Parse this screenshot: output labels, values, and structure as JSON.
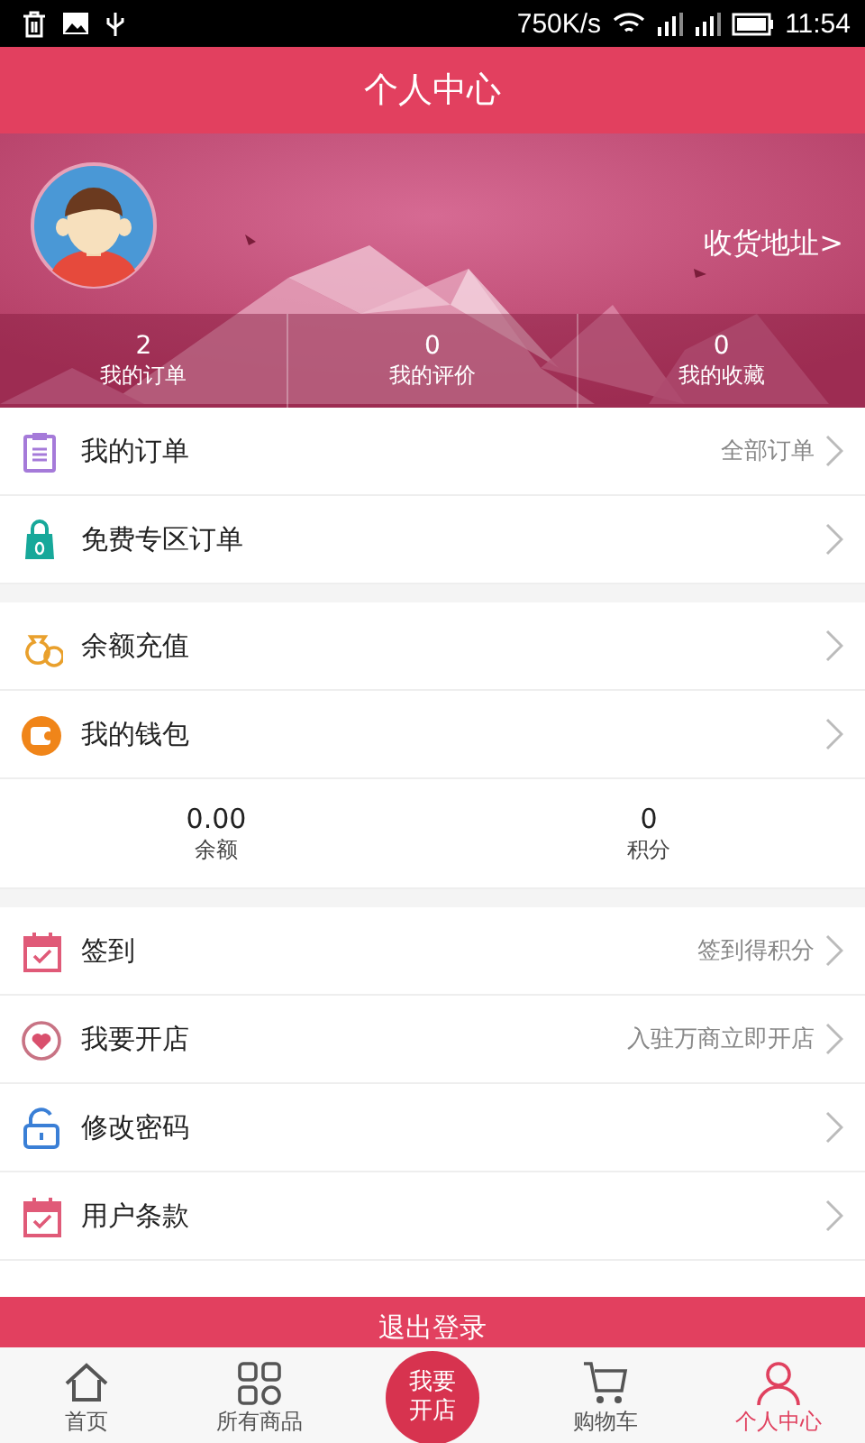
{
  "status_bar": {
    "speed": "750K/s",
    "time": "11:54"
  },
  "header": {
    "title": "个人中心"
  },
  "profile": {
    "address_link": "收货地址",
    "address_arrow": ">",
    "stats": [
      {
        "value": "2",
        "label": "我的订单"
      },
      {
        "value": "0",
        "label": "我的评价"
      },
      {
        "value": "0",
        "label": "我的收藏"
      }
    ]
  },
  "groups": [
    {
      "items": [
        {
          "kind": "clipboard",
          "label": "我的订单",
          "hint": "全部订单"
        },
        {
          "kind": "bag",
          "label": "免费专区订单"
        }
      ]
    },
    {
      "items": [
        {
          "kind": "moneybag",
          "label": "余额充值"
        },
        {
          "kind": "wallet",
          "label": "我的钱包"
        }
      ],
      "balances": [
        {
          "value": "0.00",
          "label": "余额"
        },
        {
          "value": "0",
          "label": "积分"
        }
      ]
    },
    {
      "items": [
        {
          "kind": "calendar",
          "label": "签到",
          "hint": "签到得积分"
        },
        {
          "kind": "heart",
          "label": "我要开店",
          "hint": "入驻万商立即开店"
        },
        {
          "kind": "lock",
          "label": "修改密码"
        },
        {
          "kind": "calendar",
          "label": "用户条款"
        }
      ]
    }
  ],
  "logout_button": "退出登录",
  "tabs": [
    {
      "kind": "home",
      "label": "首页",
      "selected": false
    },
    {
      "kind": "grid",
      "label": "所有商品",
      "selected": false
    },
    {
      "kind": "center",
      "label": "我要开店",
      "selected": false
    },
    {
      "kind": "cart",
      "label": "购物车",
      "selected": false
    },
    {
      "kind": "person",
      "label": "个人中心",
      "selected": true
    }
  ]
}
